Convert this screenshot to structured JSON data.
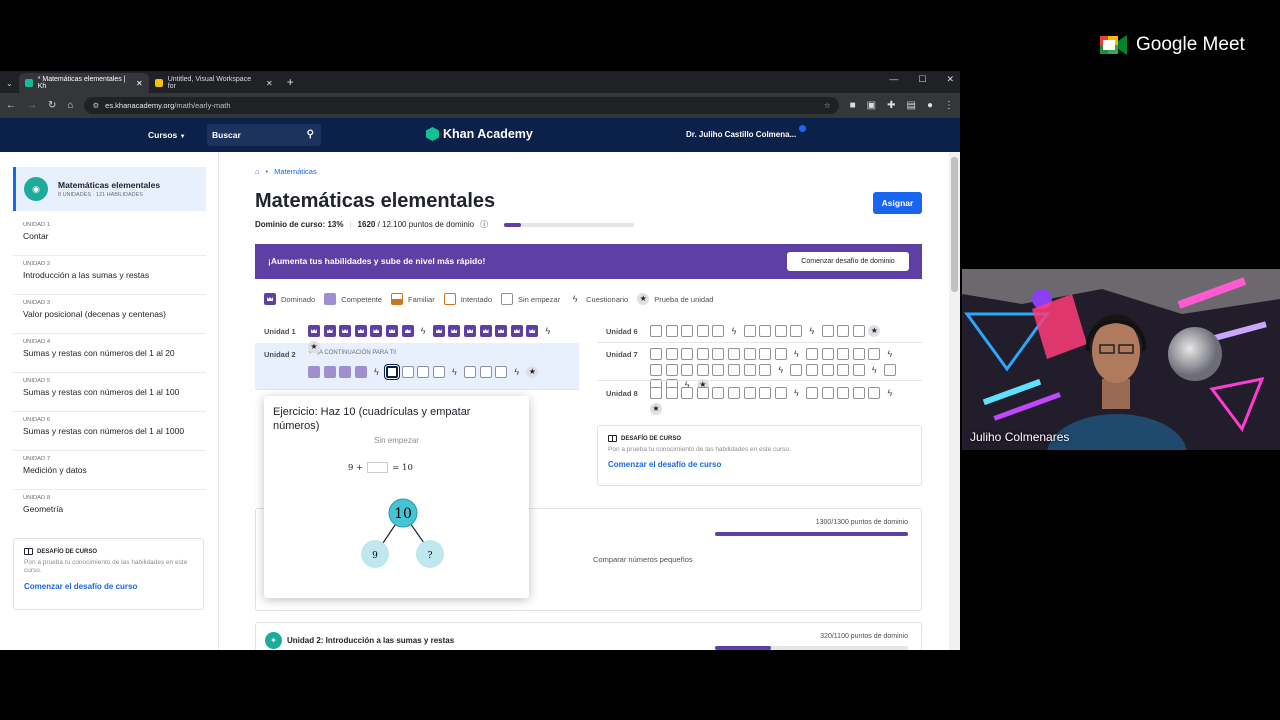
{
  "meet": {
    "title": "Google Meet"
  },
  "browser": {
    "tabs": [
      {
        "label": "* Matemáticas elementales | Kh",
        "active": true
      },
      {
        "label": "Untitled, Visual Workspace for",
        "active": false
      }
    ],
    "url_domain": "es.khanacademy.org",
    "url_path": "/math/early-math"
  },
  "header": {
    "courses": "Cursos",
    "search_placeholder": "Buscar",
    "logo": "Khan Academy",
    "user": "Dr. Juliho Castillo Colmena..."
  },
  "sidebar": {
    "course_title": "Matemáticas elementales",
    "course_meta": "8 UNIDADES · 121 HABILIDADES",
    "units": [
      {
        "num": "UNIDAD 1",
        "title": "Contar"
      },
      {
        "num": "UNIDAD 2",
        "title": "Introducción a las sumas y restas"
      },
      {
        "num": "UNIDAD 3",
        "title": "Valor posicional (decenas y centenas)"
      },
      {
        "num": "UNIDAD 4",
        "title": "Sumas y restas con números del 1 al 20"
      },
      {
        "num": "UNIDAD 5",
        "title": "Sumas y restas con números del 1 al 100"
      },
      {
        "num": "UNIDAD 6",
        "title": "Sumas y restas con números del 1 al 1000"
      },
      {
        "num": "UNIDAD 7",
        "title": "Medición y datos"
      },
      {
        "num": "UNIDAD 8",
        "title": "Geometría"
      }
    ],
    "challenge": {
      "heading": "DESAFÍO DE CURSO",
      "desc": "Pon a prueba tu conocimiento de las habilidades en este curso.",
      "link": "Comenzar el desafío de curso"
    }
  },
  "main": {
    "breadcrumb": "Matemáticas",
    "title": "Matemáticas elementales",
    "mastery_label": "Dominio de curso: 13%",
    "mastery_percent": 13,
    "points_current": "1620",
    "points_total": "/ 12.100 puntos de dominio",
    "assign": "Asignar",
    "banner_text": "¡Aumenta tus habilidades y sube de nivel más rápido!",
    "banner_button": "Comenzar desafío de dominio",
    "legend": [
      "Dominado",
      "Competente",
      "Familiar",
      "Intentado",
      "Sin empezar",
      "Cuestionario",
      "Prueba de unidad"
    ],
    "units": [
      {
        "label": "Unidad 1",
        "cells": "DDDDDDDqDDDDDDDqt"
      },
      {
        "label": "Unidad 2",
        "cells": "CCCCqXSSSqSSSqt"
      },
      {
        "label": "Unidad 6",
        "cells": "SSSSSqSSSSqSSSt"
      },
      {
        "label": "Unidad 7",
        "cells": "SSSSSSSSSqSSSSSqSSSSSSSSqSSSSSqSSSqt"
      },
      {
        "label": "Unidad 8",
        "cells": "SSSSSSSSSqSSSSSqt"
      }
    ],
    "next_label": "¡A CONTINUACIÓN PARA TI!",
    "right_challenge": {
      "heading": "DESAFÍO DE CURSO",
      "desc": "Pon a prueba tu conocimiento de las habilidades en este curso.",
      "link": "Comenzar el desafío de curso"
    },
    "section1": {
      "points": "1300/1300 puntos de dominio",
      "progress": 1.0,
      "skill": "Comparar números pequeños"
    },
    "section2": {
      "title": "Unidad 2: Introducción a las sumas y restas",
      "points": "320/1100 puntos de dominio",
      "progress": 0.29
    }
  },
  "popup": {
    "title": "Ejercicio: Haz 10 (cuadrículas y empatar números)",
    "status": "Sin empezar",
    "eq_left": "9 +",
    "eq_right": "= 10",
    "top_node": "10",
    "left_node": "9",
    "right_node": "?"
  },
  "video": {
    "name": "Juliho Colmenares"
  }
}
